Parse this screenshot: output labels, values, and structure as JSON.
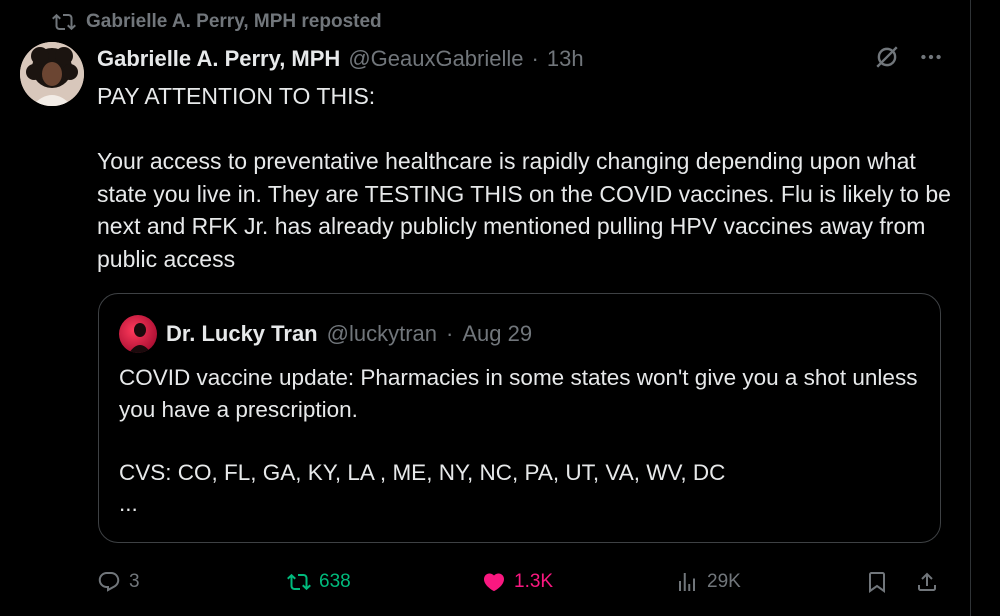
{
  "repost": {
    "label": "Gabrielle A. Perry, MPH reposted"
  },
  "post": {
    "author_name": "Gabrielle A. Perry, MPH",
    "handle": "@GeauxGabrielle",
    "separator": "·",
    "time": "13h",
    "text": "PAY ATTENTION TO THIS:\n\nYour access to preventative healthcare is rapidly changing depending upon what state you live in. They are TESTING THIS on the COVID vaccines. Flu is likely to be next and RFK Jr. has already publicly mentioned pulling HPV vaccines away from public access"
  },
  "quote": {
    "author_name": "Dr. Lucky Tran",
    "handle": "@luckytran",
    "separator": "·",
    "time": "Aug 29",
    "text": "COVID vaccine update: Pharmacies in some states won't give you a shot unless you have a prescription.\n\nCVS: CO, FL, GA, KY, LA , ME, NY, NC, PA, UT, VA, WV, DC\n..."
  },
  "actions": {
    "replies": "3",
    "reposts": "638",
    "likes": "1.3K",
    "views": "29K"
  },
  "icons": {
    "repost_header": "repost-icon",
    "grok": "grok-icon",
    "more": "more-icon",
    "reply": "reply-icon",
    "repost": "repost-icon",
    "like": "heart-icon",
    "views": "views-icon",
    "bookmark": "bookmark-icon",
    "share": "share-icon"
  },
  "colors": {
    "background": "#000000",
    "text": "#e7e9ea",
    "muted": "#71767b",
    "repost_active": "#00ba7c",
    "like_active": "#f91880",
    "border": "#3e4144"
  }
}
